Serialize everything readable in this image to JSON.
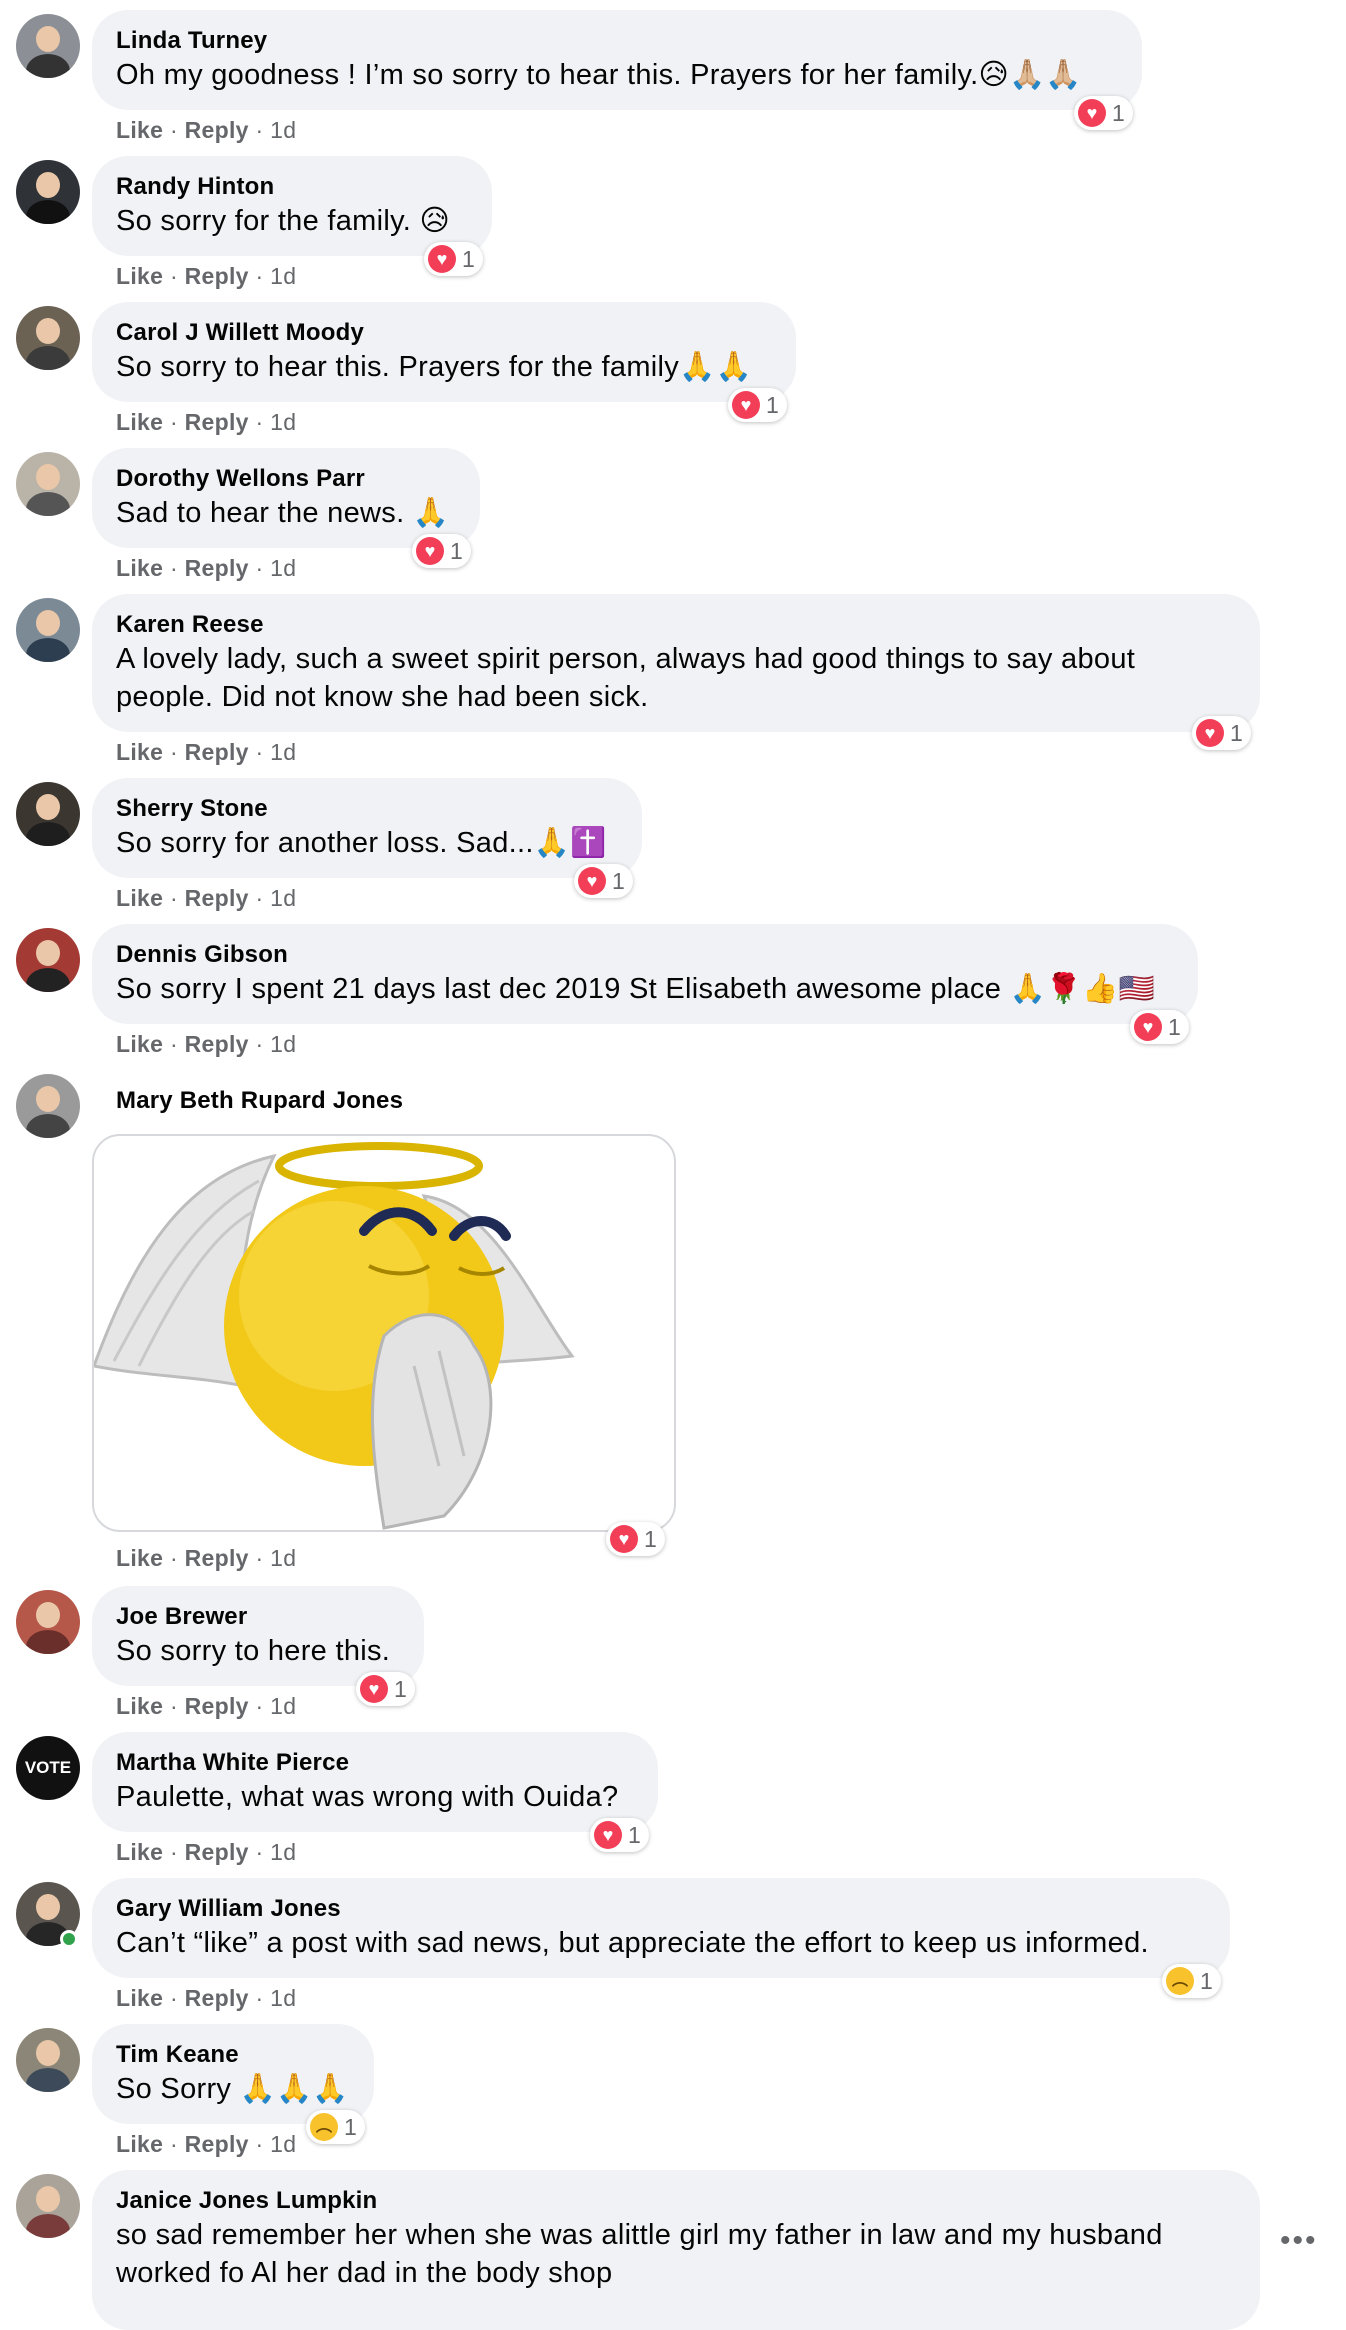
{
  "actions": {
    "like": "Like",
    "separator": "·",
    "reply": "Reply",
    "time": "1d"
  },
  "colors": {
    "bubble": "#f0f2f5",
    "meta": "#65676b",
    "heart": "#f33e58",
    "sad": "#f7c22b",
    "online": "#31a24c"
  },
  "comments": [
    {
      "name": "Linda Turney",
      "text": "Oh my goodness ! I’m so sorry to hear this. Prayers for her family.😥🙏🏼🙏🏼",
      "reaction": "heart-icon",
      "count": "1"
    },
    {
      "name": "Randy Hinton",
      "text": "So sorry for the family. 😥",
      "reaction": "heart-icon",
      "count": "1"
    },
    {
      "name": "Carol J Willett Moody",
      "text": "So sorry to hear this. Prayers for the family🙏🙏",
      "reaction": "heart-icon",
      "count": "1"
    },
    {
      "name": "Dorothy Wellons Parr",
      "text": "Sad to hear the news. 🙏",
      "reaction": "heart-icon",
      "count": "1"
    },
    {
      "name": "Karen Reese",
      "text": "A lovely lady, such a sweet spirit person, always had good things to say about people. Did not know she had been sick.",
      "reaction": "heart-icon",
      "count": "1"
    },
    {
      "name": "Sherry Stone",
      "text": "So sorry for another loss. Sad...🙏✝️",
      "reaction": "heart-icon",
      "count": "1"
    },
    {
      "name": "Dennis Gibson",
      "text": "So sorry I spent 21 days last dec 2019 St Elisabeth awesome place 🙏🌹👍🇺🇸",
      "reaction": "heart-icon",
      "count": "1"
    },
    {
      "name": "Mary Beth Rupard Jones",
      "text": "",
      "reaction": "heart-icon",
      "count": "1",
      "attachment": "praying-angel-emoji-gif"
    },
    {
      "name": "Joe Brewer",
      "text": "So sorry to here this.",
      "reaction": "heart-icon",
      "count": "1"
    },
    {
      "name": "Martha White Pierce",
      "text": "Paulette, what was wrong with Ouida?",
      "reaction": "heart-icon",
      "count": "1",
      "avatar_text": "VOTE"
    },
    {
      "name": "Gary William Jones",
      "text": "Can’t “like” a post with sad news, but appreciate the effort to keep us informed.",
      "reaction": "sad-icon",
      "count": "1",
      "online": true
    },
    {
      "name": "Tim Keane",
      "text": "So Sorry 🙏🙏🙏",
      "reaction": "sad-icon",
      "count": "1"
    },
    {
      "name": "Janice Jones Lumpkin",
      "text": "so sad remember her when she was alittle girl my father in law and my husband worked fo Al her dad in the body shop",
      "reaction": "heart-icon",
      "count": ""
    }
  ],
  "more_options_icon": "ellipsis-icon"
}
